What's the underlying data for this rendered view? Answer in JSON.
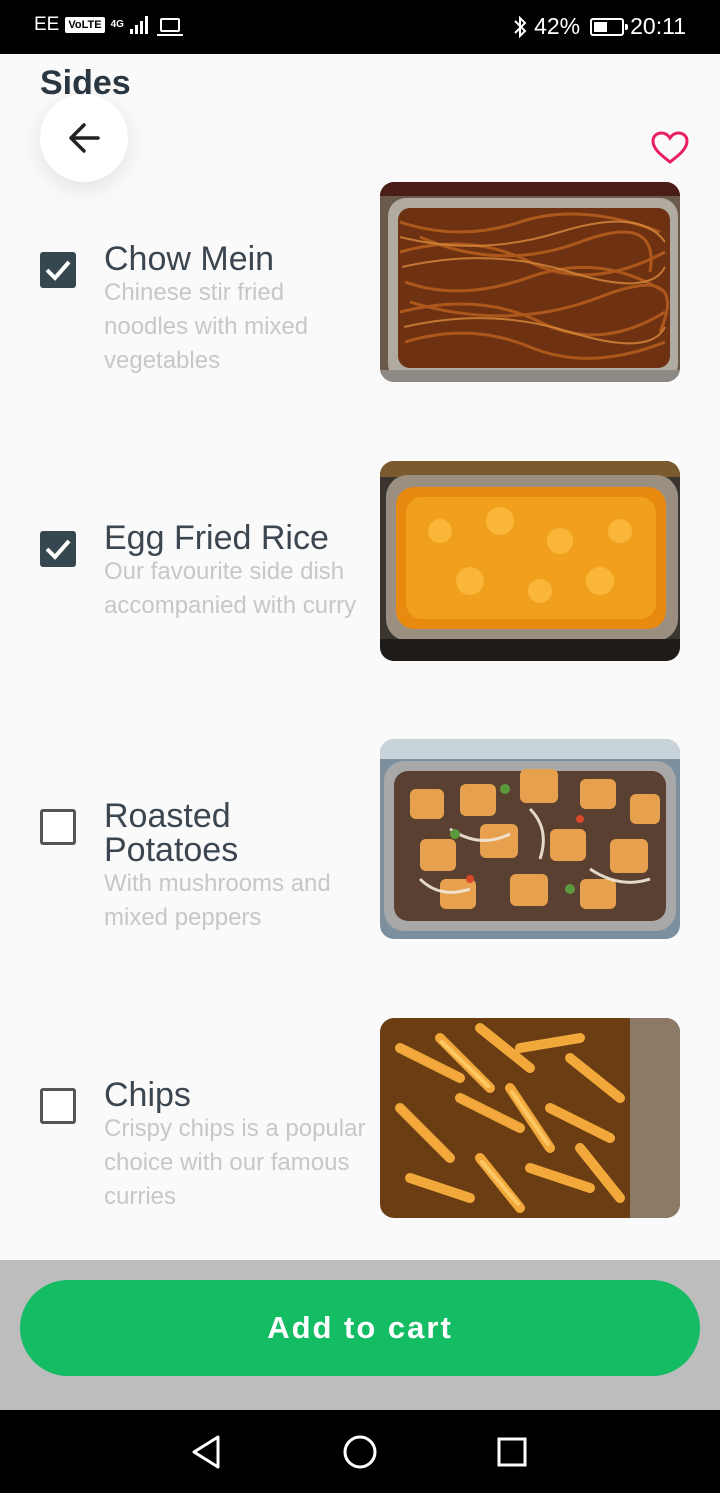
{
  "status_bar": {
    "carrier": "EE",
    "volte": "VoLTE",
    "network": "4G",
    "battery_percent": "42%",
    "time": "20:11",
    "icons": [
      "signal-icon",
      "laptop-icon",
      "bluetooth-icon",
      "battery-icon"
    ]
  },
  "header": {
    "title": "Sides",
    "back_icon": "arrow-left-icon",
    "favorite_icon": "heart-outline-icon",
    "favorite_color": "#e91e63"
  },
  "items": [
    {
      "name": "Chow Mein",
      "description": "Chinese stir fried noodles with mixed vegetables",
      "checked": true,
      "photo": "noodles"
    },
    {
      "name": "Egg Fried Rice",
      "description": "Our favourite side dish accompanied with curry",
      "checked": true,
      "photo": "rice"
    },
    {
      "name": "Roasted Potatoes",
      "description": "With mushrooms and mixed peppers",
      "checked": false,
      "photo": "potatoes"
    },
    {
      "name": "Chips",
      "description": "Crispy chips is a popular choice with our famous curries",
      "checked": false,
      "photo": "chips"
    }
  ],
  "cart": {
    "label": "Add to cart",
    "color": "#14bc63"
  },
  "nav": {
    "back_icon": "triangle-back-icon",
    "home_icon": "circle-home-icon",
    "recents_icon": "square-recents-icon"
  }
}
